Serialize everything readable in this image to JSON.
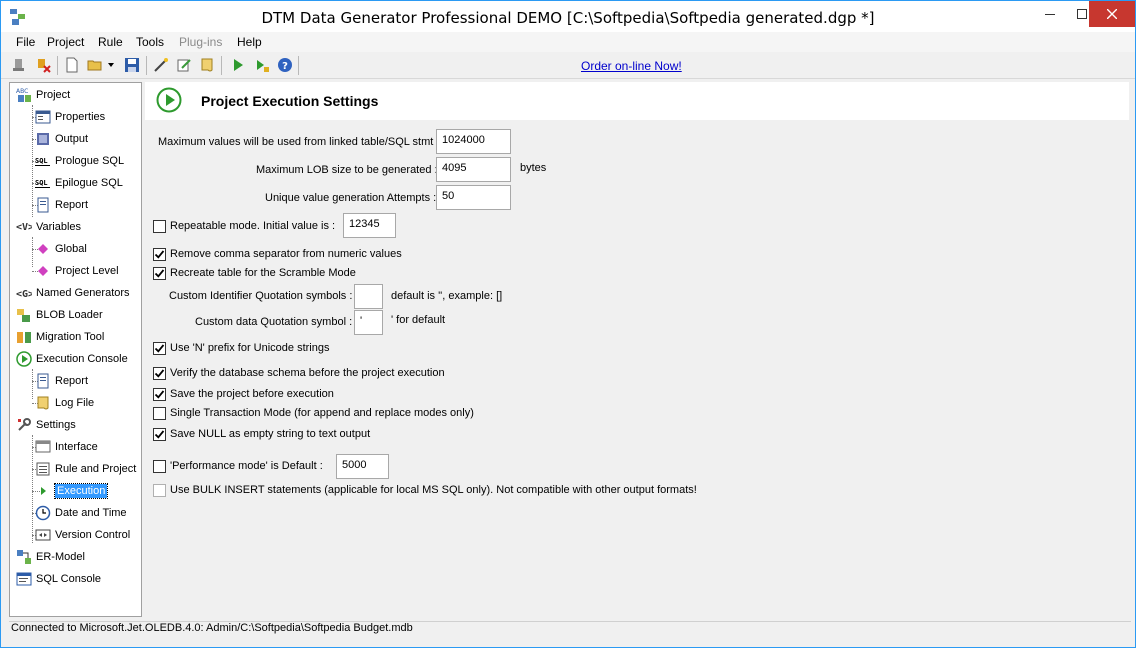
{
  "window": {
    "title": "DTM Data Generator Professional DEMO [C:\\Softpedia\\Softpedia generated.dgp *]"
  },
  "menu": [
    "File",
    "Project",
    "Rule",
    "Tools",
    "Plug-ins",
    "Help"
  ],
  "menu_disabled": [
    "Plug-ins"
  ],
  "toolbar": {
    "order_link": "Order on-line Now!",
    "icons": [
      "stamp-icon",
      "delete-rule-icon",
      "new-file-icon",
      "open-folder-icon",
      "dropdown-arrow-icon",
      "save-icon",
      "magic-icon",
      "edit-icon",
      "script-icon",
      "run-icon",
      "run-step-icon",
      "help-icon"
    ]
  },
  "tree": {
    "items": [
      {
        "label": "Project",
        "icon": "project-icon",
        "level": 0
      },
      {
        "label": "Properties",
        "icon": "properties-icon",
        "level": 1
      },
      {
        "label": "Output",
        "icon": "output-icon",
        "level": 1
      },
      {
        "label": "Prologue SQL",
        "icon": "sql-icon",
        "level": 1
      },
      {
        "label": "Epilogue SQL",
        "icon": "sql-icon",
        "level": 1
      },
      {
        "label": "Report",
        "icon": "report-icon",
        "level": 1
      },
      {
        "label": "Variables",
        "icon": "variables-icon",
        "level": 0
      },
      {
        "label": "Global",
        "icon": "variable-diamond-icon",
        "level": 1
      },
      {
        "label": "Project Level",
        "icon": "variable-diamond-icon",
        "level": 1
      },
      {
        "label": "Named Generators",
        "icon": "generator-icon",
        "level": 0
      },
      {
        "label": "BLOB Loader",
        "icon": "blob-loader-icon",
        "level": 0
      },
      {
        "label": "Migration Tool",
        "icon": "migration-icon",
        "level": 0
      },
      {
        "label": "Execution Console",
        "icon": "execution-icon",
        "level": 0
      },
      {
        "label": "Report",
        "icon": "report-icon",
        "level": 1
      },
      {
        "label": "Log File",
        "icon": "log-scroll-icon",
        "level": 1
      },
      {
        "label": "Settings",
        "icon": "settings-icon",
        "level": 0
      },
      {
        "label": "Interface",
        "icon": "interface-icon",
        "level": 1
      },
      {
        "label": "Rule and Project",
        "icon": "rule-icon",
        "level": 1
      },
      {
        "label": "Execution",
        "icon": "play-small-icon",
        "level": 1,
        "selected": true
      },
      {
        "label": "Date and Time",
        "icon": "clock-icon",
        "level": 1
      },
      {
        "label": "Version Control",
        "icon": "version-icon",
        "level": 1
      },
      {
        "label": "ER-Model",
        "icon": "er-model-icon",
        "level": 0
      },
      {
        "label": "SQL Console",
        "icon": "sql-console-icon",
        "level": 0
      }
    ]
  },
  "panel": {
    "title": "Project Execution Settings",
    "max_values_label": "Maximum values will be used from linked table/SQL stmt :",
    "max_values": "1024000",
    "max_lob_label": "Maximum LOB size to be generated :",
    "max_lob": "4095",
    "bytes_unit": "bytes",
    "attempts_label": "Unique value generation Attempts :",
    "attempts": "50",
    "repeatable_label": "Repeatable mode. Initial value is :",
    "repeatable_checked": false,
    "repeatable_value": "12345",
    "remove_comma_label": "Remove comma separator from numeric values",
    "remove_comma_checked": true,
    "recreate_table_label": "Recreate table for the Scramble Mode",
    "recreate_table_checked": true,
    "ident_quote_label": "Custom Identifier Quotation symbols :",
    "ident_quote_value": "",
    "ident_quote_hint": "default is '', example: []",
    "data_quote_label": "Custom data Quotation symbol :",
    "data_quote_value": "'",
    "data_quote_hint": "' for default",
    "n_prefix_label": "Use 'N' prefix for Unicode strings",
    "n_prefix_checked": true,
    "verify_schema_label": "Verify the database schema before the project execution",
    "verify_schema_checked": true,
    "save_before_label": "Save the project before execution",
    "save_before_checked": true,
    "single_tx_label": "Single Transaction Mode (for append and replace modes only)",
    "single_tx_checked": false,
    "save_null_label": "Save NULL as empty string to text output",
    "save_null_checked": true,
    "performance_label": "'Performance mode' is Default :",
    "performance_checked": false,
    "performance_value": "5000",
    "bulk_insert_label": "Use BULK INSERT statements (applicable for local MS SQL only). Not compatible with other output formats!",
    "bulk_insert_checked": false
  },
  "status": {
    "text": "Connected to Microsoft.Jet.OLEDB.4.0: Admin/C:\\Softpedia\\Softpedia Budget.mdb"
  },
  "colors": {
    "accent": "#3399ff",
    "window_border": "#2b9af3",
    "close_button": "#c7372f",
    "link": "#0000cc",
    "run_green": "#2e9a2e"
  }
}
